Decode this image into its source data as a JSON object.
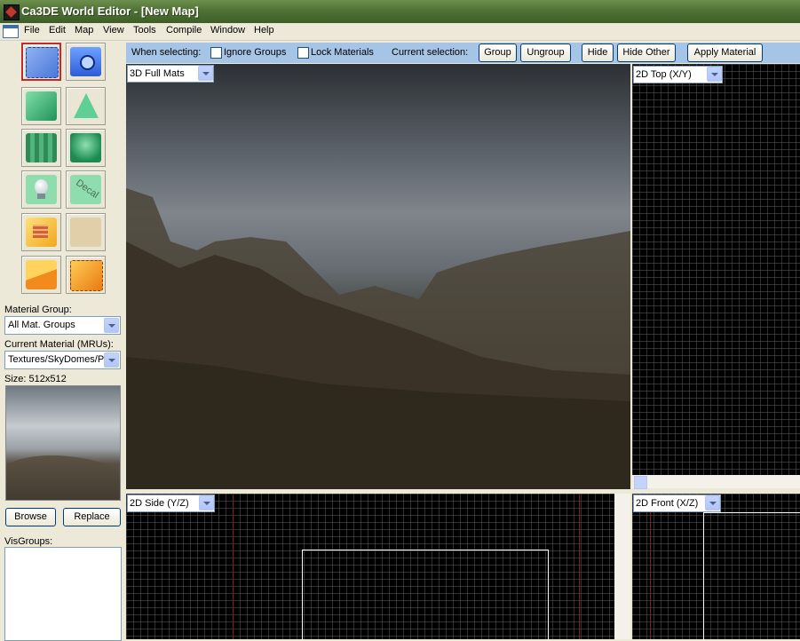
{
  "window": {
    "title": "Ca3DE World Editor - [New Map]"
  },
  "menu": {
    "items": [
      "File",
      "Edit",
      "Map",
      "View",
      "Tools",
      "Compile",
      "Window",
      "Help"
    ]
  },
  "toolbox": {
    "material_group_label": "Material Group:",
    "material_group_value": "All Mat. Groups",
    "current_material_label": "Current Material (MRUs):",
    "current_material_value": "Textures/SkyDomes/PK",
    "size_label": "Size: 512x512",
    "browse_label": "Browse",
    "replace_label": "Replace",
    "visgroups_label": "VisGroups:",
    "decal_text": "Decal"
  },
  "selection_bar": {
    "when_selecting": "When selecting:",
    "ignore_groups": "Ignore Groups",
    "lock_materials": "Lock Materials",
    "current_selection": "Current selection:",
    "group": "Group",
    "ungroup": "Ungroup",
    "hide": "Hide",
    "hide_other": "Hide Other",
    "apply_material": "Apply Material"
  },
  "viewports": {
    "main3d": "3D Full Mats",
    "top2d": "2D Top (X/Y)",
    "side2d": "2D Side (Y/Z)",
    "front2d": "2D Front (X/Z)"
  },
  "colors": {
    "title_bar": "#4f7235",
    "selection_bar": "#a6c4e6",
    "selected_tool_border": "#c62828"
  }
}
